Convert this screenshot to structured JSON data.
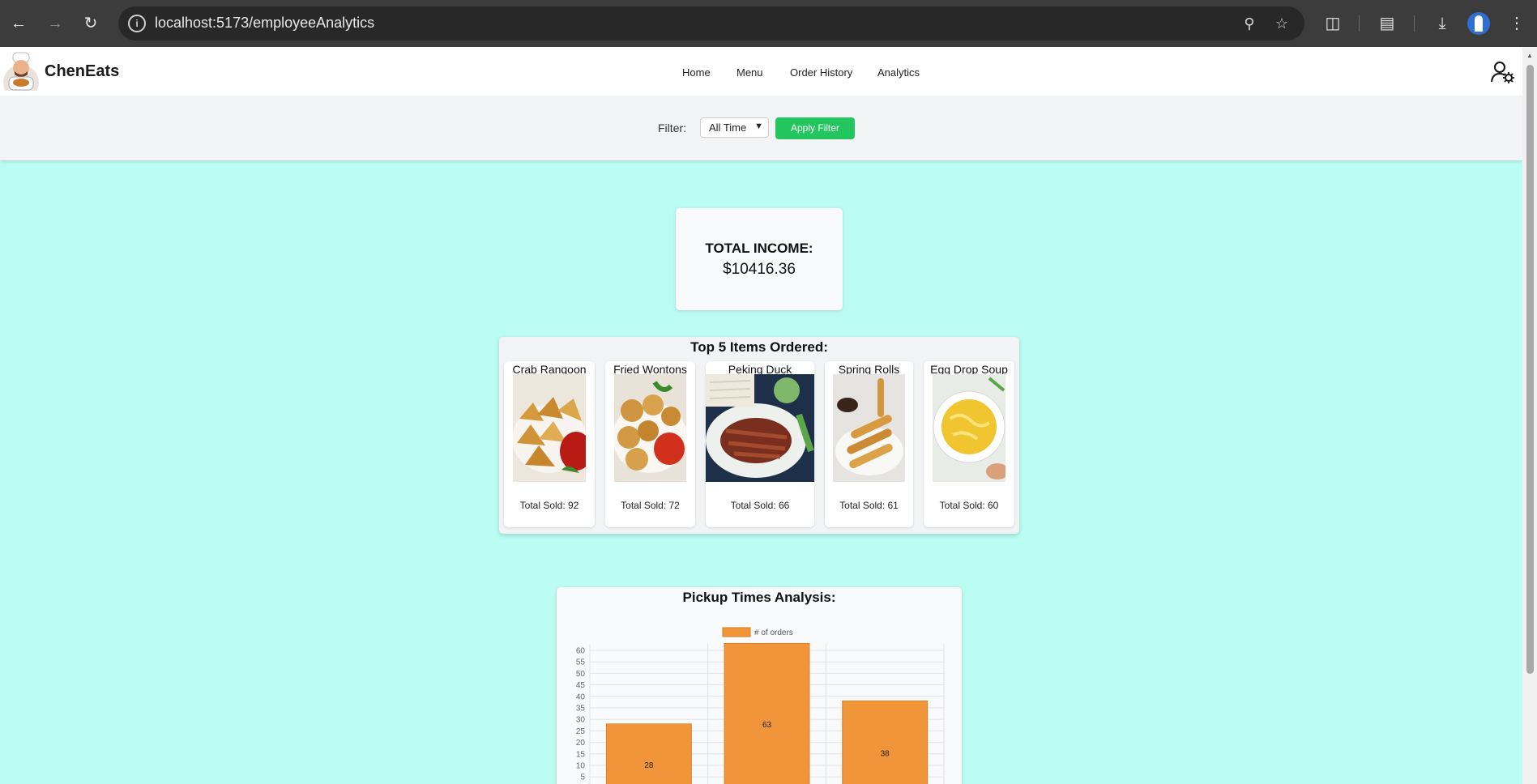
{
  "browser": {
    "url": "localhost:5173/employeeAnalytics",
    "icons": [
      "back-arrow-icon",
      "forward-arrow-icon",
      "reload-icon",
      "info-icon",
      "zoom-icon",
      "star-icon",
      "extensions-icon",
      "search-tabs-icon",
      "download-icon",
      "profile-avatar-icon",
      "more-vert-icon"
    ]
  },
  "nav": {
    "brand": "ChenEats",
    "links": [
      "Home",
      "Menu",
      "Order History",
      "Analytics"
    ]
  },
  "filter": {
    "label": "Filter:",
    "selected": "All Time",
    "apply_label": "Apply Filter",
    "accent": "#22c55e"
  },
  "income": {
    "label": "TOTAL INCOME:",
    "value": "$10416.36"
  },
  "top_items": {
    "title": "Top 5 Items Ordered:",
    "items": [
      {
        "name": "Crab Rangoon",
        "sold": "Total Sold: 92"
      },
      {
        "name": "Fried Wontons",
        "sold": "Total Sold: 72"
      },
      {
        "name": "Peking Duck",
        "sold": "Total Sold: 66"
      },
      {
        "name": "Spring Rolls",
        "sold": "Total Sold: 61"
      },
      {
        "name": "Egg Drop Soup",
        "sold": "Total Sold: 60"
      }
    ]
  },
  "pickup": {
    "title": "Pickup Times Analysis:"
  },
  "chart_data": {
    "type": "bar",
    "title": "Pickup Times Analysis:",
    "legend": "# of orders",
    "legend_position": "top",
    "bar_color": "#f0953a",
    "values": [
      28,
      63,
      38
    ],
    "data_labels": [
      "28",
      "63",
      "38"
    ],
    "yticks": [
      "60",
      "55",
      "50",
      "45",
      "40",
      "35",
      "30",
      "25",
      "20",
      "15",
      "10",
      "5"
    ],
    "ylim": [
      0,
      63
    ],
    "grid": true
  }
}
